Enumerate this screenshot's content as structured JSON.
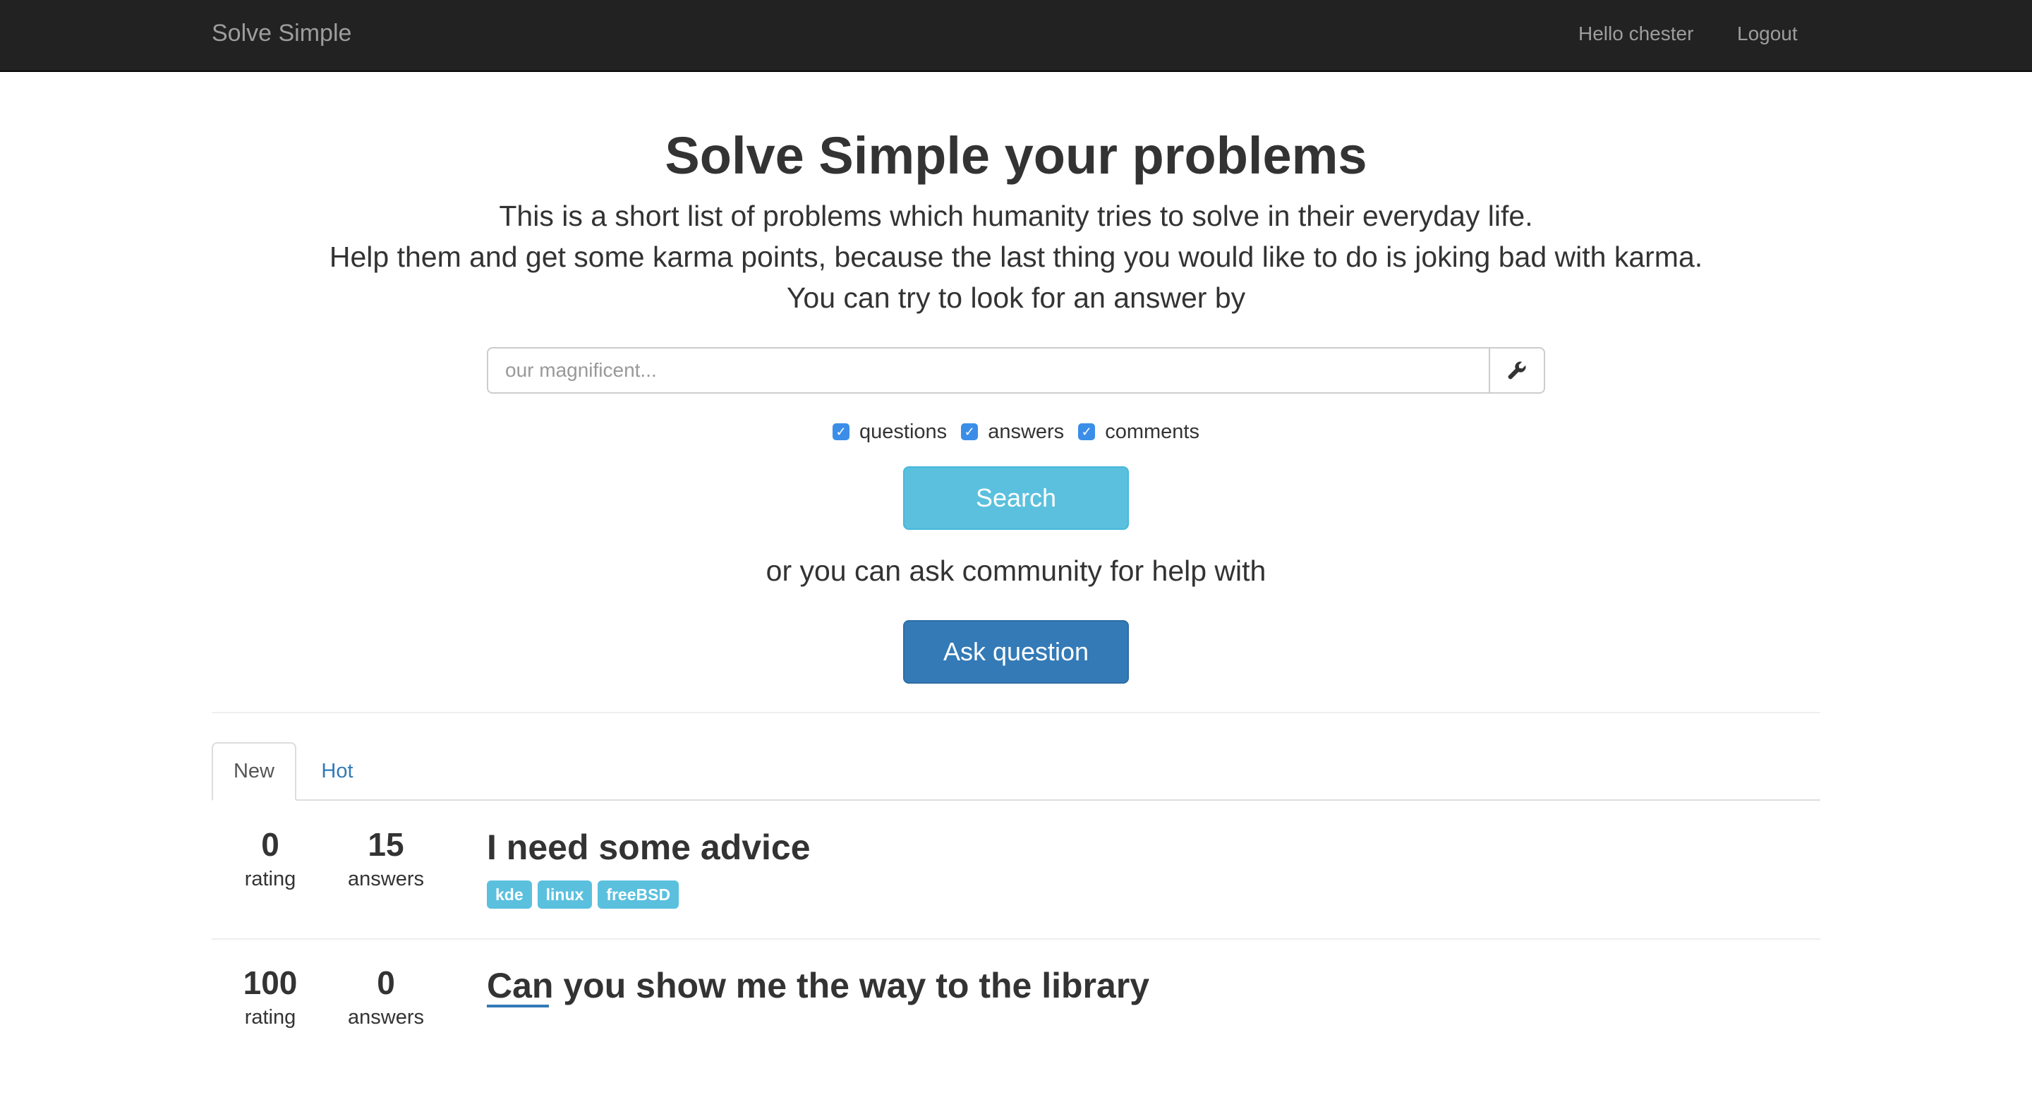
{
  "navbar": {
    "brand": "Solve Simple",
    "greeting": "Hello chester",
    "logout": "Logout"
  },
  "hero": {
    "title": "Solve Simple your problems",
    "line1": "This is a short list of problems which humanity tries to solve in their everyday life.",
    "line2": "Help them and get some karma points, because the last thing you would like to do is joking bad with karma.",
    "line3": "You can try to look for an answer by"
  },
  "search": {
    "placeholder": "our magnificent...",
    "value": "",
    "addon_icon": "wrench-icon",
    "filters": [
      {
        "label": "questions",
        "checked": true
      },
      {
        "label": "answers",
        "checked": true
      },
      {
        "label": "comments",
        "checked": true
      }
    ],
    "button": "Search"
  },
  "ask": {
    "prompt": "or you can ask community for help with",
    "button": "Ask question"
  },
  "tabs": [
    {
      "label": "New",
      "active": true
    },
    {
      "label": "Hot",
      "active": false
    }
  ],
  "questions": [
    {
      "rating": "0",
      "rating_label": "rating",
      "answers": "15",
      "answers_label": "answers",
      "title": "I need some advice",
      "tags": [
        "kde",
        "linux",
        "freeBSD"
      ]
    },
    {
      "rating": "100",
      "rating_label": "rating",
      "answers": "0",
      "answers_label": "answers",
      "title": "Can you show me the way to the library",
      "tags": []
    }
  ],
  "colors": {
    "navbar": "#222222",
    "info": "#5bc0de",
    "primary": "#337ab7",
    "checkbox": "#3b8ee8"
  }
}
